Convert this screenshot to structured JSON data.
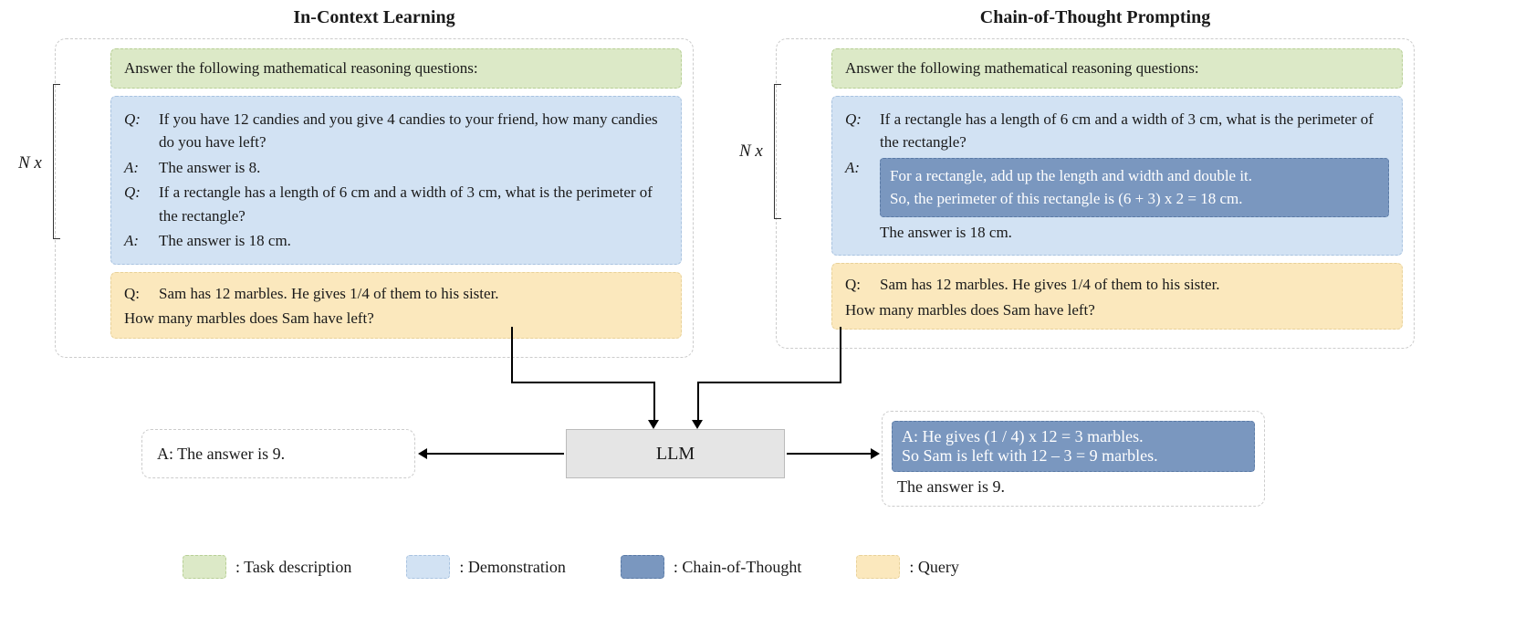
{
  "titles": {
    "left": "In-Context Learning",
    "right": "Chain-of-Thought Prompting"
  },
  "nlabel": "N x",
  "left": {
    "task": "Answer the following mathematical reasoning questions:",
    "demo": {
      "q1_label": "Q:",
      "q1": "If you have 12 candies and you give 4 candies to your friend, how many candies do you have left?",
      "a1_label": "A:",
      "a1": "The answer is 8.",
      "q2_label": "Q:",
      "q2": "If a rectangle has a length of 6 cm and a width of 3 cm, what is the perimeter of the rectangle?",
      "a2_label": "A:",
      "a2": "The answer is 18 cm."
    },
    "query": {
      "label": "Q:",
      "line1": "Sam has 12 marbles. He gives 1/4 of them to his sister.",
      "line2": "How many marbles does Sam have left?"
    },
    "output": "A: The answer is 9."
  },
  "right": {
    "task": "Answer the following mathematical reasoning questions:",
    "demo": {
      "q_label": "Q:",
      "q": "If a rectangle has a length of 6 cm and a width of 3 cm, what is the perimeter of the rectangle?",
      "a_label": "A:",
      "cot_line1": "For a rectangle, add up the length and width and double it.",
      "cot_line2": "So, the perimeter of this rectangle is (6 + 3) x 2 = 18 cm.",
      "a_final": "The answer is 18 cm."
    },
    "query": {
      "label": "Q:",
      "line1": "Sam has 12 marbles. He gives 1/4 of them to his sister.",
      "line2": "How many marbles does Sam have left?"
    },
    "output": {
      "cot_line1": "A: He gives (1 / 4) x 12 = 3 marbles.",
      "cot_line2": "So Sam is left with 12 – 3 = 9 marbles.",
      "final": "The answer is 9."
    }
  },
  "llm": "LLM",
  "legend": {
    "task": ": Task description",
    "demo": ": Demonstration",
    "cot": ": Chain-of-Thought",
    "query": ": Query"
  }
}
